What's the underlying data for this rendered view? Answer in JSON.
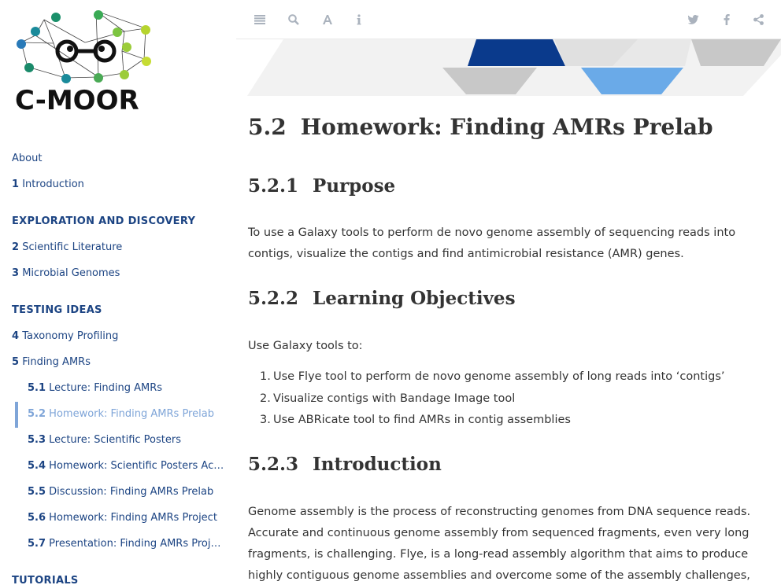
{
  "logo": {
    "text": "C-MOOR"
  },
  "sidebar": {
    "about": "About",
    "intro": {
      "num": "1",
      "label": "Introduction"
    },
    "section1": "EXPLORATION AND DISCOVERY",
    "item2": {
      "num": "2",
      "label": "Scientific Literature"
    },
    "item3": {
      "num": "3",
      "label": "Microbial Genomes"
    },
    "section2": "TESTING IDEAS",
    "item4": {
      "num": "4",
      "label": "Taxonomy Profiling"
    },
    "item5": {
      "num": "5",
      "label": "Finding AMRs"
    },
    "sub": [
      {
        "num": "5.1",
        "label": "Lecture: Finding AMRs"
      },
      {
        "num": "5.2",
        "label": "Homework: Finding AMRs Prelab"
      },
      {
        "num": "5.3",
        "label": "Lecture: Scientific Posters"
      },
      {
        "num": "5.4",
        "label": "Homework: Scientific Posters Acti…"
      },
      {
        "num": "5.5",
        "label": "Discussion: Finding AMRs Prelab"
      },
      {
        "num": "5.6",
        "label": "Homework: Finding AMRs Project"
      },
      {
        "num": "5.7",
        "label": "Presentation: Finding AMRs Project"
      }
    ],
    "section3": "TUTORIALS"
  },
  "toolbar": {
    "icons": [
      "menu-icon",
      "search-icon",
      "font-icon",
      "info-icon",
      "twitter-icon",
      "facebook-icon",
      "share-icon"
    ],
    "icon_color": "#aab2bd"
  },
  "content": {
    "h2": {
      "num": "5.2",
      "title": "Homework: Finding AMRs Prelab"
    },
    "purpose": {
      "num": "5.2.1",
      "title": "Purpose"
    },
    "purpose_text": "To use a Galaxy tools to perform de novo genome assembly of sequencing reads into contigs, visualize the contigs and find antimicrobial resistance (AMR) genes.",
    "objectives": {
      "num": "5.2.2",
      "title": "Learning Objectives"
    },
    "objectives_intro": "Use Galaxy tools to:",
    "objectives_list": [
      {
        "num": "1.",
        "text": "Use Flye tool to perform de novo genome assembly of long reads into ‘contigs’"
      },
      {
        "num": "2.",
        "text": "Visualize contigs with Bandage Image tool"
      },
      {
        "num": "3.",
        "text": "Use ABRicate tool to find AMRs in contig assemblies"
      }
    ],
    "intro": {
      "num": "5.2.3",
      "title": "Introduction"
    },
    "intro_text": "Genome assembly is the process of reconstructing genomes from DNA sequence reads. Accurate and continuous genome assembly from sequenced fragments, even very long fragments, is challenging. Flye, is a long-read assembly algorithm that aims to produce highly contiguous genome assemblies and overcome some of the assembly challenges,"
  },
  "colors": {
    "link": "#1c4483",
    "active": "#7fa5d8",
    "banner_dark": "#0a3a8c",
    "banner_light": "#6aaae8",
    "banner_grey": "#c8c8c8"
  }
}
